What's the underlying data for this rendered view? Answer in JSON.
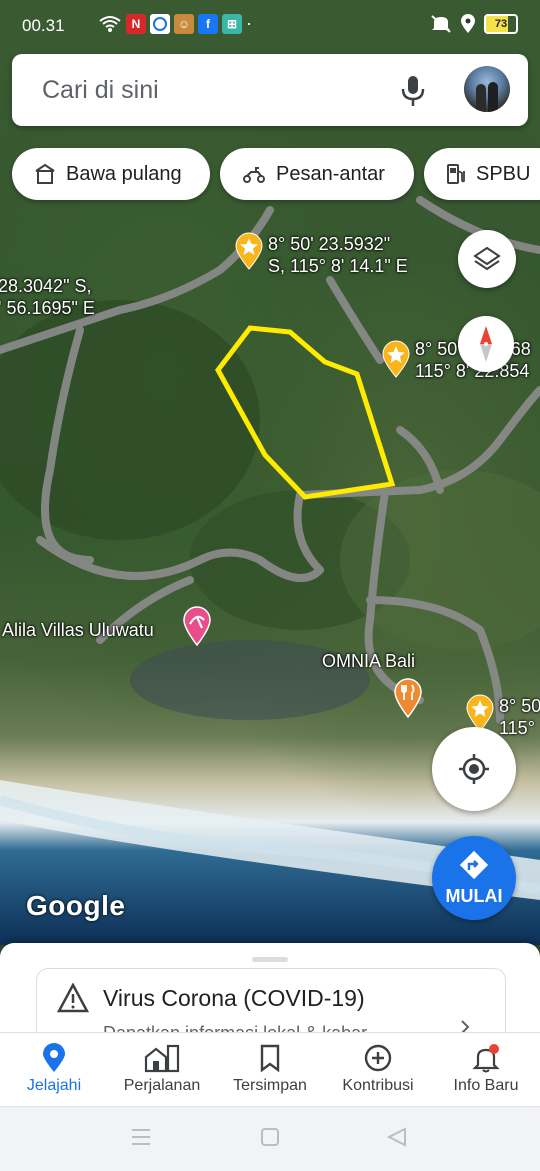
{
  "status_bar": {
    "time": "00.31",
    "battery": "73"
  },
  "search": {
    "placeholder": "Cari di sini"
  },
  "chips": [
    {
      "label": "Bawa pulang",
      "icon": "takeout-bag-icon"
    },
    {
      "label": "Pesan-antar",
      "icon": "scooter-icon"
    },
    {
      "label": "SPBU",
      "icon": "gas-pump-icon"
    }
  ],
  "map": {
    "pins": [
      {
        "line1": "8° 50' 23.5932\"",
        "line2": "S, 115° 8' 14.1\" E"
      },
      {
        "line1": "8° 50' 22.4268",
        "line2": "115° 8' 22.854"
      },
      {
        "line1": "8° 50",
        "line2": "115°"
      }
    ],
    "edge_coord": {
      "line1": "28.3042\" S,",
      "line2": "' 56.1695\" E"
    },
    "places": [
      {
        "name": "Alila Villas Uluwatu",
        "icon": "hotel-pin-icon",
        "color": "#e94e8a"
      },
      {
        "name": "OMNIA Bali",
        "icon": "restaurant-pin-icon",
        "color": "#f08a30"
      }
    ],
    "outline_color": "#ffeb00",
    "logo": "Google"
  },
  "start_button": {
    "label": "MULAI"
  },
  "sheet": {
    "title": "Virus Corona (COVID-19)",
    "subtitle": "Dapatkan informasi lokal & kabar"
  },
  "nav": [
    {
      "label": "Jelajahi"
    },
    {
      "label": "Perjalanan"
    },
    {
      "label": "Tersimpan"
    },
    {
      "label": "Kontribusi"
    },
    {
      "label": "Info Baru"
    }
  ],
  "colors": {
    "accent": "#1a73e8",
    "notification": "#ea4335"
  }
}
